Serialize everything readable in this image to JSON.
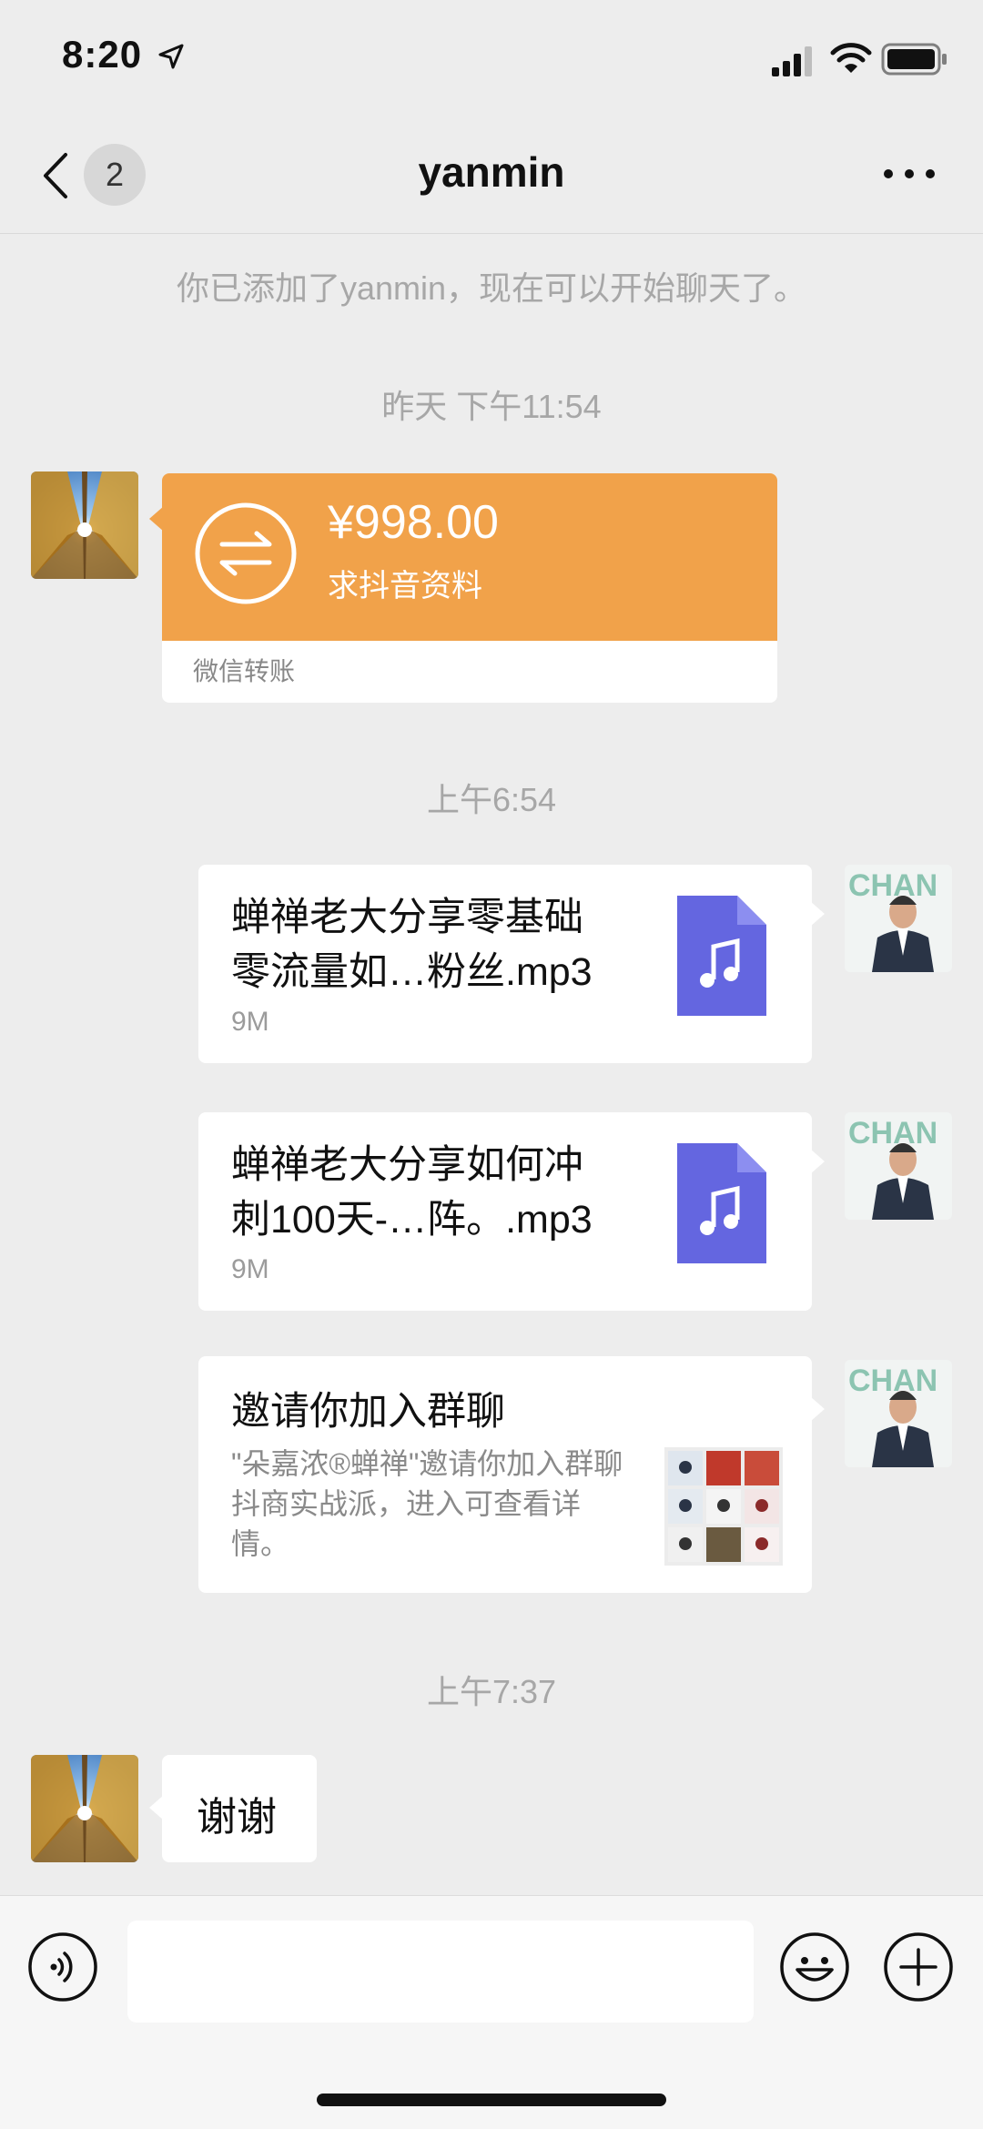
{
  "status_bar": {
    "time": "8:20"
  },
  "header": {
    "badge_count": "2",
    "title": "yanmin"
  },
  "messages": {
    "system_notice": "你已添加了yanmin，现在可以开始聊天了。",
    "timestamp_1": "昨天 下午11:54",
    "transfer": {
      "amount": "¥998.00",
      "memo": "求抖音资料",
      "footer": "微信转账"
    },
    "timestamp_2": "上午6:54",
    "file_1": {
      "name_line1": "蝉禅老大分享零基础",
      "name_line2": "零流量如…粉丝.mp3",
      "size": "9M"
    },
    "file_2": {
      "name_line1": "蝉禅老大分享如何冲",
      "name_line2": "刺100天-…阵。.mp3",
      "size": "9M"
    },
    "invite": {
      "title": "邀请你加入群聊",
      "desc": "\"朵嘉浓®蝉禅\"邀请你加入群聊抖商实战派，进入可查看详情。"
    },
    "timestamp_3": "上午7:37",
    "reply": "谢谢"
  },
  "avatar_right_text": "CHAN",
  "colors": {
    "transfer_orange": "#f1a24a",
    "file_icon_purple": "#6466e0"
  },
  "icons": [
    "location-arrow-icon",
    "signal-icon",
    "wifi-icon",
    "battery-icon",
    "back-chevron-icon",
    "more-dots-icon",
    "transfer-arrows-icon",
    "music-file-icon",
    "voice-icon",
    "emoji-icon",
    "plus-icon"
  ]
}
